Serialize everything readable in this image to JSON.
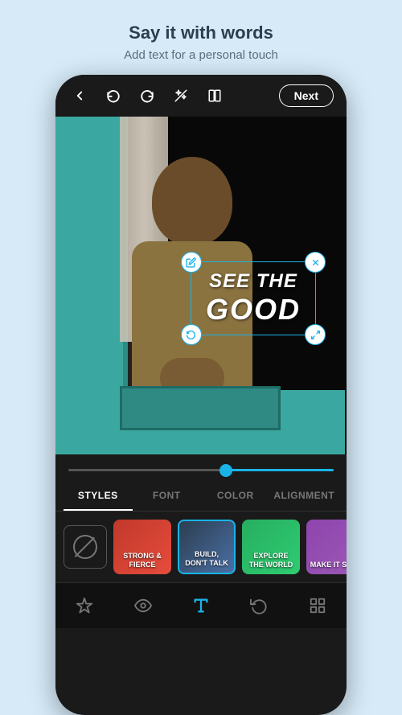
{
  "header": {
    "title": "Say it with words",
    "subtitle": "Add text for a personal touch"
  },
  "toolbar": {
    "back_icon": "←",
    "undo_icon": "↺",
    "redo_icon": "↻",
    "magic_icon": "✦",
    "compare_icon": "⊟",
    "next_label": "Next"
  },
  "text_overlay": {
    "line1": "SEE THE",
    "line2": "GOOD"
  },
  "tabs": [
    {
      "label": "STYLES",
      "active": true
    },
    {
      "label": "FONT",
      "active": false
    },
    {
      "label": "COLOR",
      "active": false
    },
    {
      "label": "ALIGNMENT",
      "active": false
    }
  ],
  "style_cards": [
    {
      "id": "none",
      "label": ""
    },
    {
      "id": "strong-fierce",
      "label": "STRONG & FIERCE",
      "bg": "red"
    },
    {
      "id": "build-dont-talk",
      "label": "BUILD, DON'T TALK",
      "bg": "blue",
      "active": true
    },
    {
      "id": "explore-the-world",
      "label": "EXPLORE THE WORLD",
      "bg": "green"
    },
    {
      "id": "make-it-significant",
      "label": "MAKE IT SIGNIF...",
      "bg": "purple"
    }
  ],
  "bottom_nav": [
    {
      "icon": "✦",
      "name": "magic",
      "active": false
    },
    {
      "icon": "👁",
      "name": "preview",
      "active": false
    },
    {
      "icon": "T",
      "name": "text",
      "active": true
    },
    {
      "icon": "↺",
      "name": "history",
      "active": false
    },
    {
      "icon": "⊞",
      "name": "layers",
      "active": false
    }
  ],
  "slider": {
    "value": 60,
    "min": 0,
    "max": 100
  }
}
